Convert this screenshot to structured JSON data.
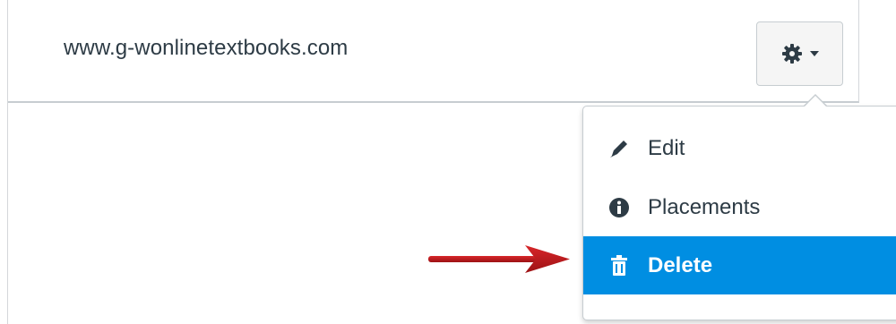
{
  "row": {
    "domain_text": "www.g-wonlinetextbooks.com"
  },
  "settings_button": {
    "icon": "gear-icon",
    "caret_icon": "caret-down-icon"
  },
  "menu": {
    "items": [
      {
        "label": "Edit",
        "icon": "pencil-icon"
      },
      {
        "label": "Placements",
        "icon": "info-icon"
      },
      {
        "label": "Delete",
        "icon": "trash-icon",
        "highlighted": true
      }
    ]
  },
  "annotation": {
    "arrow": "red-arrow-icon",
    "arrow_color": "#c0191b"
  },
  "colors": {
    "highlight": "#008ee2",
    "text": "#2d3b45",
    "border": "#c7cdd1"
  }
}
